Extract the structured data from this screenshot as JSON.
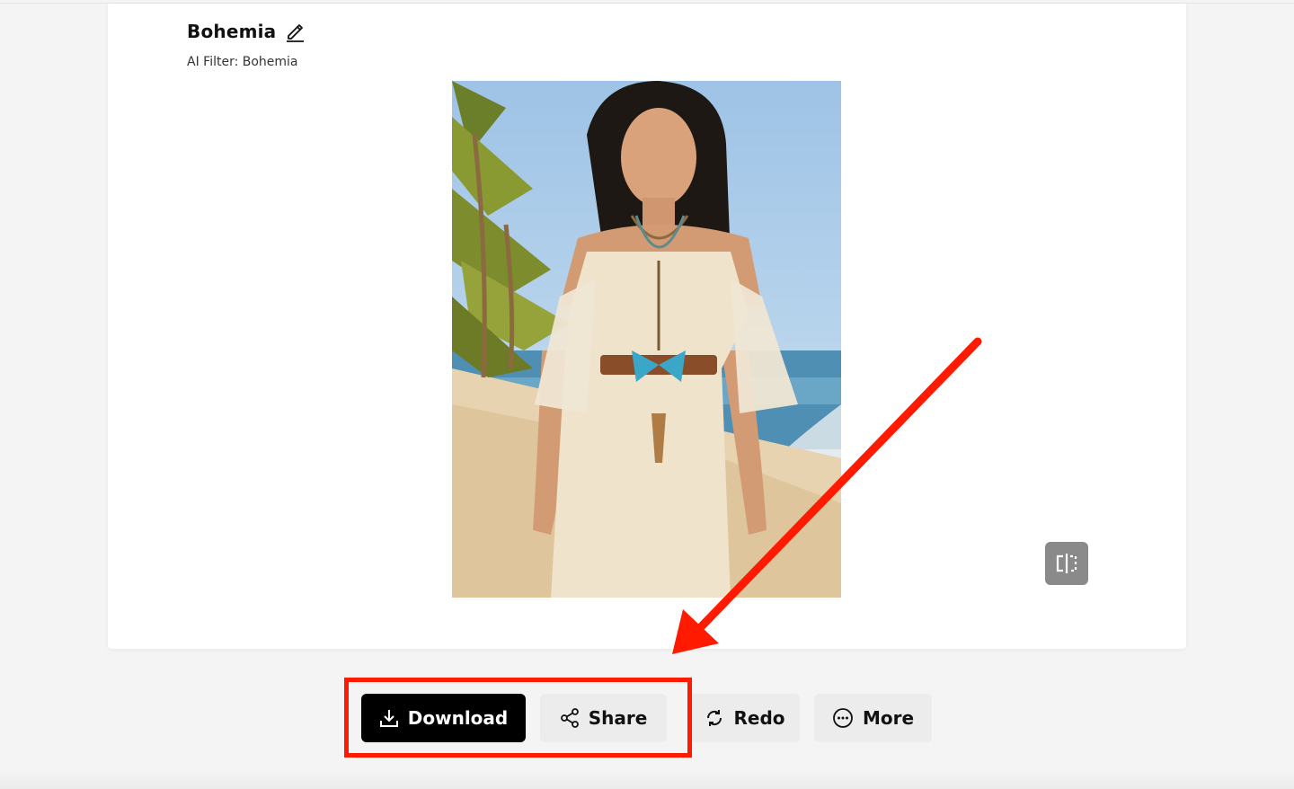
{
  "card": {
    "title": "Bohemia",
    "subtitle": "AI Filter: Bohemia"
  },
  "photo": {
    "description_icon": "generated-photo"
  },
  "actions": {
    "download_label": "Download",
    "share_label": "Share",
    "redo_label": "Redo",
    "more_label": "More"
  },
  "icons": {
    "edit": "pencil-icon",
    "compare": "compare-split-icon",
    "download": "download-icon",
    "share": "share-icon",
    "redo": "redo-icon",
    "more": "more-dots-icon"
  },
  "colors": {
    "annotation_red": "#ff1a00",
    "primary_button": "#000000",
    "secondary_button": "#ececec",
    "compare_button": "#8a8a8a"
  }
}
